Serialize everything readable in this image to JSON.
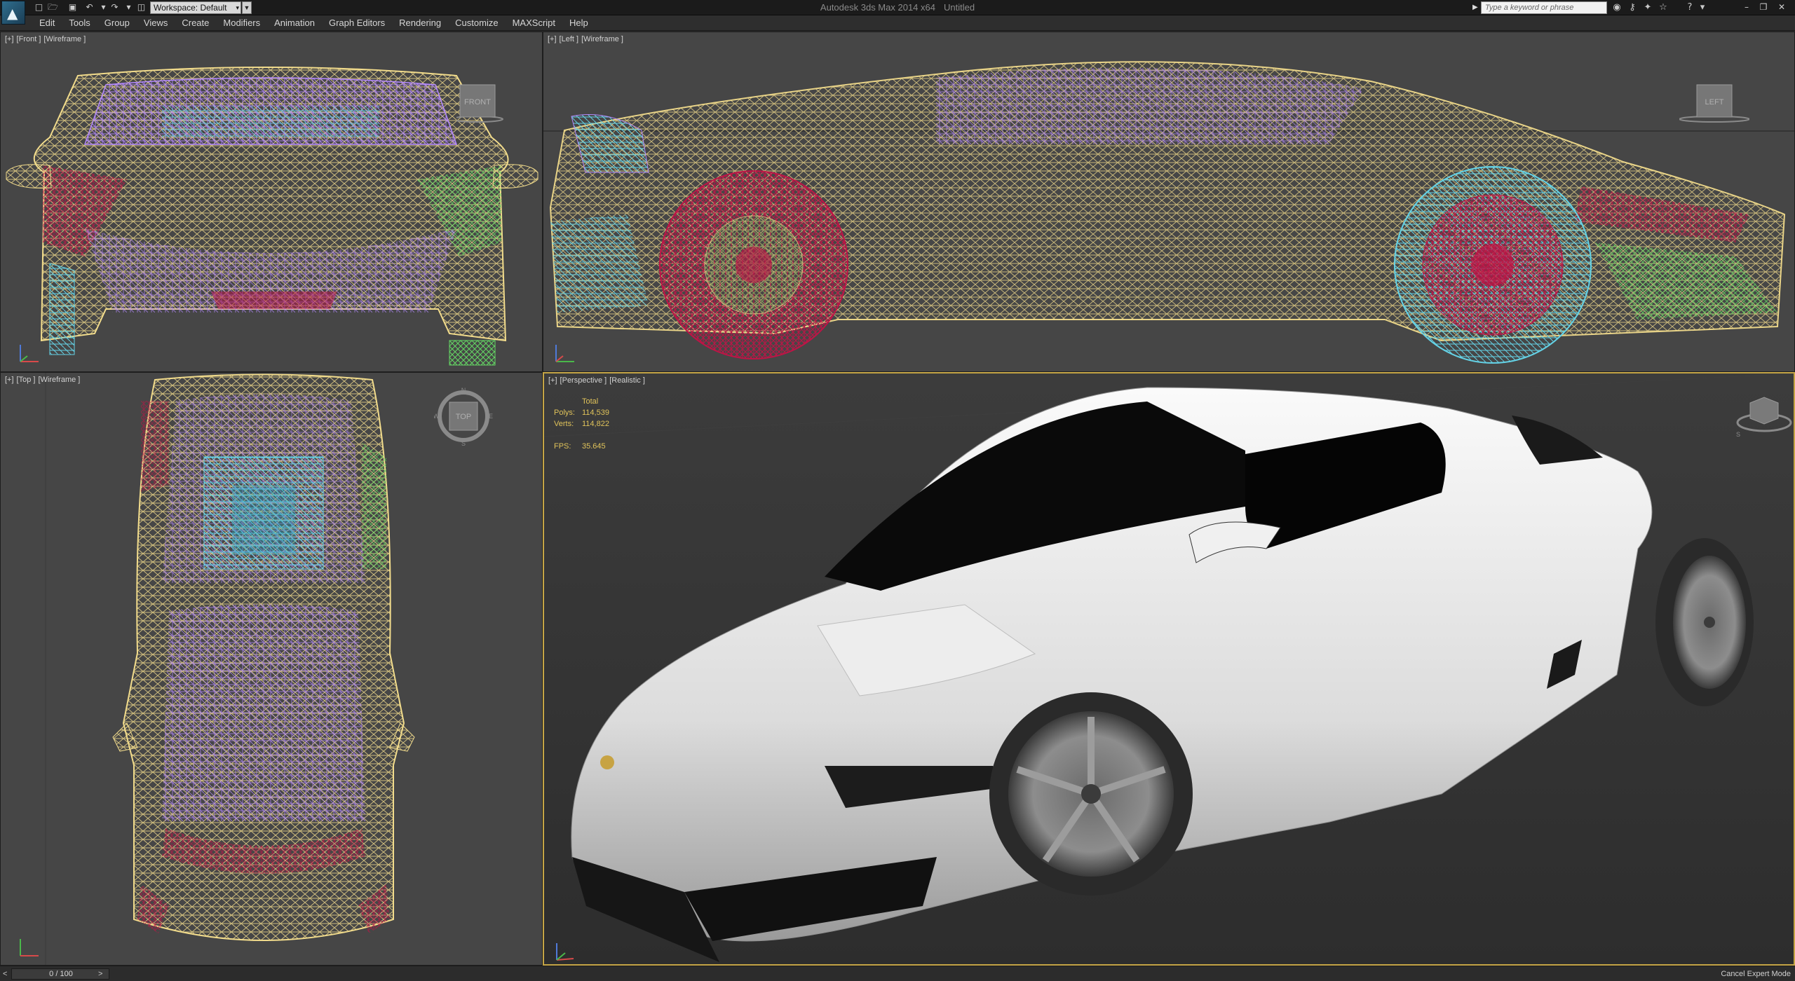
{
  "window": {
    "app_name": "Autodesk 3ds Max 2014 x64",
    "document": "Untitled",
    "workspace": "Workspace: Default",
    "search_placeholder": "Type a keyword or phrase"
  },
  "menu": [
    "Edit",
    "Tools",
    "Group",
    "Views",
    "Create",
    "Modifiers",
    "Animation",
    "Graph Editors",
    "Rendering",
    "Customize",
    "MAXScript",
    "Help"
  ],
  "viewports": {
    "front": {
      "plus": "[+]",
      "view": "[Front ]",
      "shading": "[Wireframe ]",
      "cube_label": "FRONT"
    },
    "left": {
      "plus": "[+]",
      "view": "[Left ]",
      "shading": "[Wireframe ]",
      "cube_label": "LEFT"
    },
    "top": {
      "plus": "[+]",
      "view": "[Top ]",
      "shading": "[Wireframe ]",
      "cube_label": "TOP",
      "compass_n": "N",
      "compass_s": "S",
      "compass_w": "W",
      "compass_e": "E"
    },
    "perspective": {
      "plus": "[+]",
      "view": "[Perspective ]",
      "shading": "[Realistic ]",
      "compass_s": "S"
    }
  },
  "stats": {
    "header": "Total",
    "polys_label": "Polys:",
    "polys": "114,539",
    "verts_label": "Verts:",
    "verts": "114,822",
    "fps_label": "FPS:",
    "fps": "35.645"
  },
  "timeline": {
    "position": "0 / 100",
    "prev": "<",
    "next": ">"
  },
  "status": {
    "expert_mode": "Cancel Expert Mode"
  },
  "icons": {
    "logo": "3ds-max-logo-icon",
    "toolbar": [
      "new-file-icon",
      "open-file-icon",
      "save-file-icon",
      "undo-icon",
      "redo-icon",
      "project-folder-icon"
    ],
    "infocenter": [
      "binoculars-icon",
      "key-icon",
      "satellite-icon",
      "star-icon",
      "help-icon"
    ]
  },
  "colors": {
    "wire_yellow": "#f2dc8c",
    "wire_purple": "#b58aff",
    "wire_green": "#64d864",
    "wire_cyan": "#64d2e6",
    "wire_red": "#be1446",
    "active_border": "#c5a546",
    "stats_text": "#e0c35a"
  }
}
